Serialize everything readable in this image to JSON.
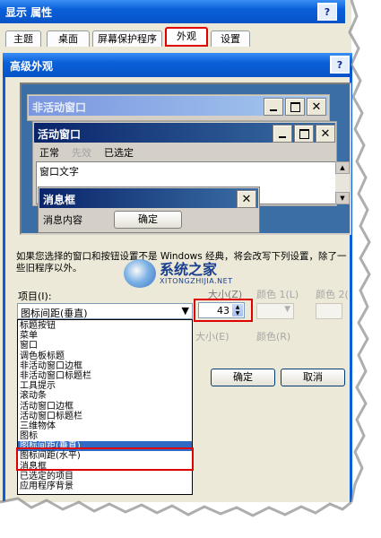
{
  "outer_window": {
    "title": "显示 属性",
    "help": "?",
    "tabs": [
      "主题",
      "桌面",
      "屏幕保护程序",
      "外观",
      "设置"
    ],
    "active_tab_index": 3
  },
  "advanced_dialog": {
    "title": "高级外观",
    "help": "?",
    "preview": {
      "inactive_title": "非活动窗口",
      "active_title": "活动窗口",
      "menu": [
        "正常",
        "先效",
        "已选定"
      ],
      "window_text": "窗口文字",
      "msgbox_title": "消息框",
      "msgbox_text": "消息内容",
      "msgbox_ok": "确定"
    },
    "note": "如果您选择的窗口和按钮设置不是 Windows 经典，将会改写下列设置，除了一些旧程序以外。",
    "item_label": "项目(I):",
    "item_selected": "图标间距(垂直)",
    "size_label_top": "大小(Z)",
    "color1_label": "颜色 1(L)",
    "color2_label": "颜色 2(",
    "size_value": "43",
    "size_label_bottom": "大小(E)",
    "color_label_bottom": "颜色(R)",
    "ok": "确定",
    "cancel": "取消",
    "list_items": [
      "标题按钮",
      "菜单",
      "窗口",
      "调色板标题",
      "非活动窗口边框",
      "非活动窗口标题栏",
      "工具提示",
      "滚动条",
      "活动窗口边框",
      "活动窗口标题栏",
      "三维物体",
      "图标",
      "图标间距(垂直)",
      "图标间距(水平)",
      "消息框",
      "已选定的项目",
      "应用程序背景"
    ],
    "list_selected_index": 12
  },
  "watermark": {
    "brand": "系统之家",
    "url": "XITONGZHIJIA.NET"
  },
  "colors": {
    "title_blue": "#0a5fd8",
    "highlight_red": "#e00000",
    "selection_blue": "#316ac5"
  }
}
